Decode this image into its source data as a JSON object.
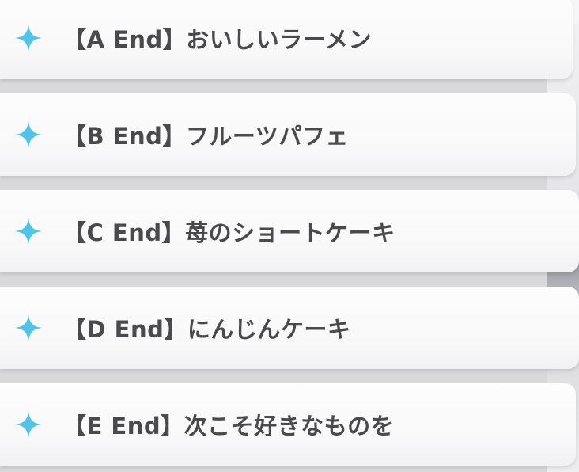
{
  "choices": [
    {
      "label": "【A End】おいしいラーメン",
      "icon": "sparkle-icon"
    },
    {
      "label": "【B End】フルーツパフェ",
      "icon": "sparkle-icon"
    },
    {
      "label": "【C End】苺のショートケーキ",
      "icon": "sparkle-icon"
    },
    {
      "label": "【D End】にんじんケーキ",
      "icon": "sparkle-icon"
    },
    {
      "label": "【E End】次こそ好きなものを",
      "icon": "sparkle-icon"
    }
  ],
  "colors": {
    "sparkle": "#4fc3e8",
    "text": "#4a4a4d",
    "card": "#fbfbfc"
  }
}
